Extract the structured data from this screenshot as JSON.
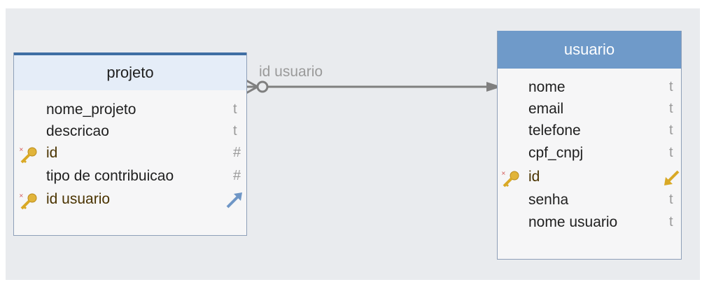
{
  "tables": {
    "projeto": {
      "title": "projeto",
      "fields": [
        {
          "name": "nome_projeto",
          "type": "t",
          "key": false
        },
        {
          "name": "descricao",
          "type": "t",
          "key": false
        },
        {
          "name": "id",
          "type": "#",
          "key": true
        },
        {
          "name": "tipo de contribuicao",
          "type": "#",
          "key": false
        },
        {
          "name": "id usuario",
          "type": "",
          "key": true,
          "ref_icon": "reference-out-arrow-icon"
        }
      ]
    },
    "usuario": {
      "title": "usuario",
      "fields": [
        {
          "name": "nome",
          "type": "t",
          "key": false
        },
        {
          "name": "email",
          "type": "t",
          "key": false
        },
        {
          "name": "telefone",
          "type": "t",
          "key": false
        },
        {
          "name": "cpf_cnpj",
          "type": "t",
          "key": false
        },
        {
          "name": "id",
          "type": "",
          "key": true,
          "ref_icon": "reference-in-arrow-icon"
        },
        {
          "name": "senha",
          "type": "t",
          "key": false
        },
        {
          "name": "nome usuario",
          "type": "t",
          "key": false
        }
      ]
    }
  },
  "relationship": {
    "label": "id usuario",
    "from": "projeto",
    "to": "usuario"
  },
  "colors": {
    "header_projeto": "#e5edf8",
    "header_usuario": "#6f9ac9",
    "line": "#7a7a7a",
    "key": "#d9a926"
  }
}
